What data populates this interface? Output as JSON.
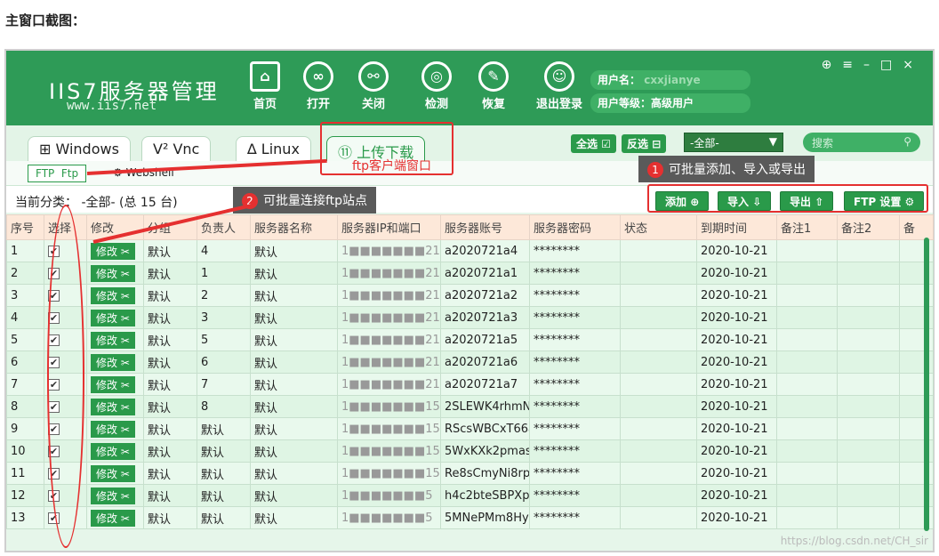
{
  "heading": "主窗口截图：",
  "app": {
    "logo": "IIS7服务器管理",
    "website": "www.iis7.net",
    "toolbar": [
      "首页",
      "打开",
      "关闭",
      "检测",
      "恢复",
      "退出登录"
    ],
    "user_label": "用户名：",
    "user_value": "cxxjianye",
    "level_label": "用户等级：高级用户",
    "window_controls": [
      "⊕",
      "≡",
      "–",
      "□",
      "×"
    ]
  },
  "tabs": [
    "Windows",
    "Vnc",
    "Linux",
    "上传下载"
  ],
  "annotation_ftp_client": "ftp客户端窗口",
  "select_all": "全选",
  "invert_select": "反选",
  "filter": "-全部-",
  "search_placeholder": "搜索",
  "subtabs": [
    "FTP",
    "Ftp",
    "Webshell"
  ],
  "category": "当前分类： -全部- (总 15 台)",
  "buttons": {
    "add": "添加",
    "import": "导入",
    "export": "导出",
    "ftp_settings": "FTP 设置"
  },
  "tips": {
    "t1": "可批量添加、导入或导出",
    "t2": "可批量连接ftp站点"
  },
  "columns": [
    "序号",
    "选择",
    "修改",
    "分组",
    "负责人",
    "服务器名称",
    "服务器IP和端口",
    "服务器账号",
    "服务器密码",
    "状态",
    "到期时间",
    "备注1",
    "备注2",
    "备"
  ],
  "rows": [
    [
      "1",
      "修改",
      "默认",
      "4",
      "默认",
      "1■■■■■■■21",
      "a2020721a4",
      "********",
      "",
      "2020-10-21"
    ],
    [
      "2",
      "修改",
      "默认",
      "1",
      "默认",
      "1■■■■■■■21",
      "a2020721a1",
      "********",
      "",
      "2020-10-21"
    ],
    [
      "3",
      "修改",
      "默认",
      "2",
      "默认",
      "1■■■■■■■21",
      "a2020721a2",
      "********",
      "",
      "2020-10-21"
    ],
    [
      "4",
      "修改",
      "默认",
      "3",
      "默认",
      "1■■■■■■■21",
      "a2020721a3",
      "********",
      "",
      "2020-10-21"
    ],
    [
      "5",
      "修改",
      "默认",
      "5",
      "默认",
      "1■■■■■■■21",
      "a2020721a5",
      "********",
      "",
      "2020-10-21"
    ],
    [
      "6",
      "修改",
      "默认",
      "6",
      "默认",
      "1■■■■■■■21",
      "a2020721a6",
      "********",
      "",
      "2020-10-21"
    ],
    [
      "7",
      "修改",
      "默认",
      "7",
      "默认",
      "1■■■■■■■21",
      "a2020721a7",
      "********",
      "",
      "2020-10-21"
    ],
    [
      "8",
      "修改",
      "默认",
      "8",
      "默认",
      "1■■■■■■■159",
      "2SLEWK4rhmN",
      "********",
      "",
      "2020-10-21"
    ],
    [
      "9",
      "修改",
      "默认",
      "默认",
      "默认",
      "1■■■■■■■159",
      "RScsWBCxT66a",
      "********",
      "",
      "2020-10-21"
    ],
    [
      "10",
      "修改",
      "默认",
      "默认",
      "默认",
      "1■■■■■■■159",
      "5WxKXk2pmasi",
      "********",
      "",
      "2020-10-21"
    ],
    [
      "11",
      "修改",
      "默认",
      "默认",
      "默认",
      "1■■■■■■■159",
      "Re8sCmyNi8rp",
      "********",
      "",
      "2020-10-21"
    ],
    [
      "12",
      "修改",
      "默认",
      "默认",
      "默认",
      "1■■■■■■■5",
      "h4c2bteSBPXpr",
      "********",
      "",
      "2020-10-21"
    ],
    [
      "13",
      "修改",
      "默认",
      "默认",
      "默认",
      "1■■■■■■■5",
      "5MNePMm8Hy",
      "********",
      "",
      "2020-10-21"
    ]
  ],
  "watermark": "https://blog.csdn.net/CH_sir"
}
